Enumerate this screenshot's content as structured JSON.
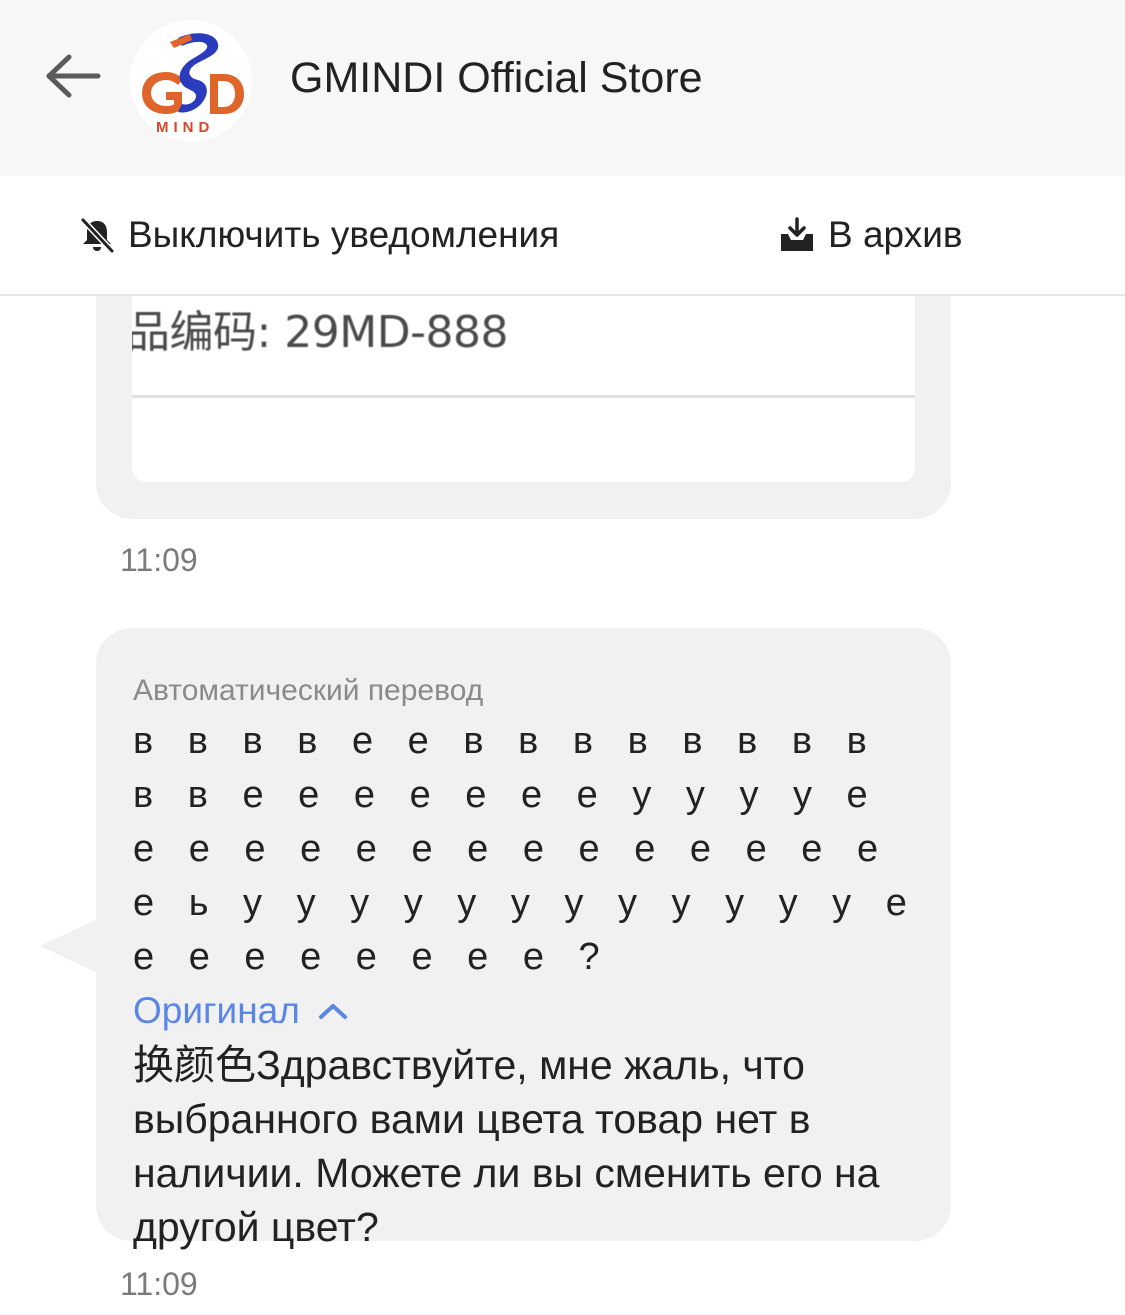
{
  "header": {
    "back_icon": "arrow-left-icon",
    "avatar_logo_text": "GSD MIND",
    "store_name": "GMINDI Official Store"
  },
  "actions": {
    "mute_label": "Выключить уведомления",
    "mute_icon": "bell-off-icon",
    "archive_label": "В архив",
    "archive_icon": "archive-tray-icon"
  },
  "messages": [
    {
      "card_cut_text": "…… … … ……. … …",
      "card_code_text": "品编码: 29MD-888",
      "time": "11:09"
    },
    {
      "auto_translation_label": "Автоматический перевод",
      "translated_text": "в в в в е е в в в в в в в в в в е е е е е е е у у у у е е е е е е е е е е е е е е е е ь у у у у у у у у у у у у е е е е е е е е е ?",
      "original_toggle_label": "Оригинал",
      "original_text": "换颜色Здравствуйте, мне жаль, что выбранного вами цвета товар нет в наличии. Можете ли вы сменить его на другой цвет?",
      "time": "11:09"
    }
  ],
  "colors": {
    "header_bg": "#f7f7f8",
    "bubble_bg": "#f1f1f1",
    "link": "#5a86e8",
    "logo_orange": "#e0652a",
    "logo_blue": "#2a3bbd"
  }
}
